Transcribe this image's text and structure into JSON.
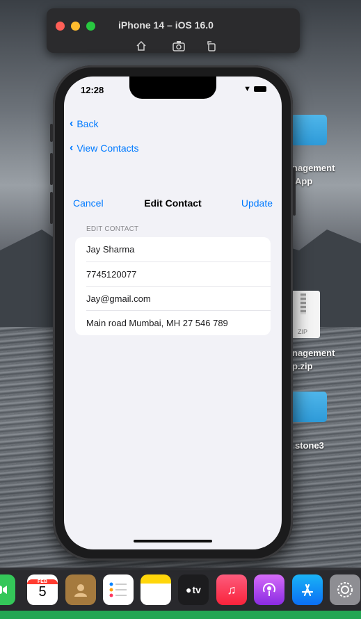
{
  "simulator": {
    "title": "iPhone 14 – iOS 16.0",
    "tools": [
      "home-icon",
      "screenshot-icon",
      "rotate-icon"
    ]
  },
  "status_bar": {
    "time": "12:28"
  },
  "navigation": {
    "back_label": "Back",
    "view_contacts_label": "View Contacts"
  },
  "edit_bar": {
    "cancel_label": "Cancel",
    "title": "Edit Contact",
    "update_label": "Update"
  },
  "form": {
    "section_header": "EDIT CONTACT",
    "fields": {
      "name": "Jay Sharma",
      "phone": "7745120077",
      "email": "Jay@gmail.com",
      "address": "Main road Mumbai, MH 27 546 789"
    }
  },
  "desktop": {
    "item1_label_line1": "nagement",
    "item1_label_line2": "App",
    "zip_badge": "ZIP",
    "item2_label_line1": "nagement",
    "item2_label_line2": "p.zip",
    "item3_label": "stone3"
  },
  "dock": {
    "calendar_month": "FEB",
    "calendar_day": "5",
    "tv_label": "tv"
  },
  "colors": {
    "accent": "#007aff",
    "folder": "#3aa7e3",
    "background": "#f2f2f7"
  }
}
